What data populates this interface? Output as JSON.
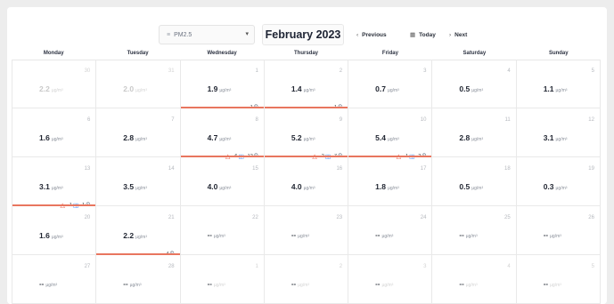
{
  "toolbar": {
    "pollutant": "PM2.5",
    "month_title": "February 2023",
    "previous_label": "Previous",
    "today_label": "Today",
    "next_label": "Next"
  },
  "weekdays": [
    "Monday",
    "Tuesday",
    "Wednesday",
    "Thursday",
    "Friday",
    "Saturday",
    "Sunday"
  ],
  "unit": "µg/m³",
  "cells": [
    {
      "day": "30",
      "value": "2.2",
      "muted": true
    },
    {
      "day": "31",
      "value": "2.0",
      "muted": true
    },
    {
      "day": "1",
      "value": "1.9",
      "badges": [
        {
          "type": "clock",
          "count": "1"
        }
      ],
      "alert": true
    },
    {
      "day": "2",
      "value": "1.4",
      "badges": [
        {
          "type": "clock",
          "count": "1"
        }
      ],
      "alert": true
    },
    {
      "day": "3",
      "value": "0.7"
    },
    {
      "day": "4",
      "value": "0.5"
    },
    {
      "day": "5",
      "value": "1.1"
    },
    {
      "day": "6",
      "value": "1.6"
    },
    {
      "day": "7",
      "value": "2.8"
    },
    {
      "day": "8",
      "value": "4.7",
      "badges": [
        {
          "type": "triangle",
          "count": ""
        },
        {
          "type": "square",
          "count": "6"
        },
        {
          "type": "clock",
          "count": "12"
        }
      ],
      "alert": true
    },
    {
      "day": "9",
      "value": "5.2",
      "badges": [
        {
          "type": "triangle",
          "count": ""
        },
        {
          "type": "square",
          "count": "2"
        },
        {
          "type": "clock",
          "count": "7"
        }
      ],
      "alert": true
    },
    {
      "day": "10",
      "value": "5.4",
      "badges": [
        {
          "type": "triangle",
          "count": ""
        },
        {
          "type": "square",
          "count": "1"
        },
        {
          "type": "clock",
          "count": "2"
        }
      ],
      "alert": true
    },
    {
      "day": "11",
      "value": "2.8"
    },
    {
      "day": "12",
      "value": "3.1"
    },
    {
      "day": "13",
      "value": "3.1",
      "badges": [
        {
          "type": "triangle",
          "count": ""
        },
        {
          "type": "square",
          "count": "1"
        },
        {
          "type": "clock",
          "count": "1"
        }
      ],
      "alert": true
    },
    {
      "day": "14",
      "value": "3.5"
    },
    {
      "day": "15",
      "value": "4.0"
    },
    {
      "day": "16",
      "value": "4.0"
    },
    {
      "day": "17",
      "value": "1.8"
    },
    {
      "day": "18",
      "value": "0.5"
    },
    {
      "day": "19",
      "value": "0.3"
    },
    {
      "day": "20",
      "value": "1.6"
    },
    {
      "day": "21",
      "value": "2.2",
      "badges": [
        {
          "type": "clock",
          "count": "4"
        }
      ],
      "alert": true
    },
    {
      "day": "22",
      "value": "--",
      "blank": true
    },
    {
      "day": "23",
      "value": "--",
      "blank": true
    },
    {
      "day": "24",
      "value": "--",
      "blank": true
    },
    {
      "day": "25",
      "value": "--",
      "blank": true
    },
    {
      "day": "26",
      "value": "--",
      "blank": true
    },
    {
      "day": "27",
      "value": "--",
      "blank": true
    },
    {
      "day": "28",
      "value": "--",
      "blank": true
    },
    {
      "day": "1",
      "value": "--",
      "blank": true,
      "muted": true
    },
    {
      "day": "2",
      "value": "--",
      "blank": true,
      "muted": true
    },
    {
      "day": "3",
      "value": "--",
      "blank": true,
      "muted": true
    },
    {
      "day": "4",
      "value": "--",
      "blank": true,
      "muted": true
    },
    {
      "day": "5",
      "value": "--",
      "blank": true,
      "muted": true
    }
  ],
  "colors": {
    "alert_line": "#e8765f",
    "triangle": "#e5533d",
    "square": "#3b82f6"
  }
}
